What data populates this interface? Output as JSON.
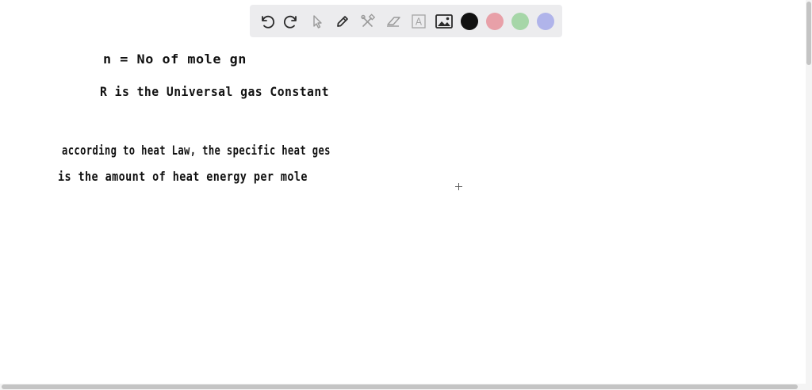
{
  "toolbar": {
    "tools": [
      {
        "name": "undo-icon"
      },
      {
        "name": "redo-icon"
      },
      {
        "name": "pointer-icon"
      },
      {
        "name": "pen-icon"
      },
      {
        "name": "tools-icon"
      },
      {
        "name": "eraser-icon"
      },
      {
        "name": "text-icon",
        "glyph": "A"
      },
      {
        "name": "image-icon"
      }
    ],
    "colors": [
      "#111111",
      "#e8a0a8",
      "#a6d6a8",
      "#b0b4ea"
    ],
    "selected_color": "#111111"
  },
  "canvas": {
    "lines": [
      "n = No of mole gn",
      "R is the Universal gas Constant",
      "according to heat Law, the specific heat ges",
      "is the amount of heat energy per mole"
    ]
  }
}
